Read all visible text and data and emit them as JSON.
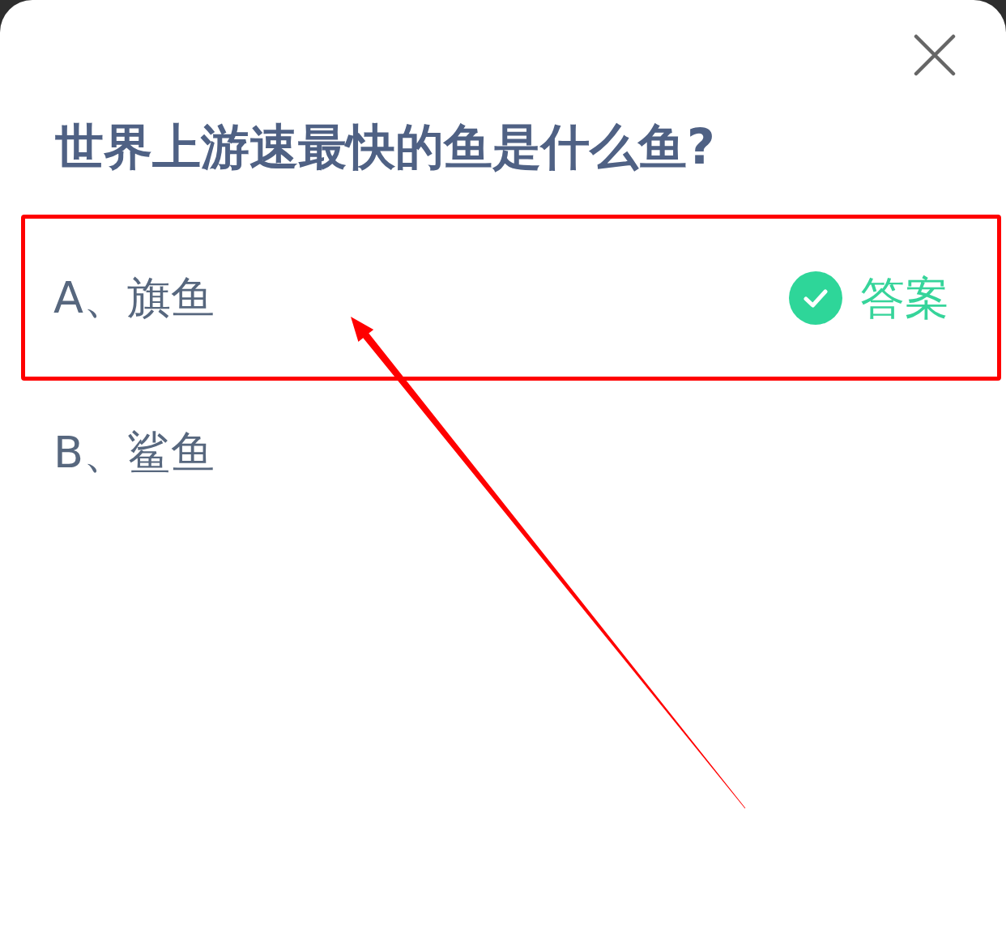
{
  "question": {
    "title": "世界上游速最快的鱼是什么鱼?"
  },
  "options": [
    {
      "label": "A、旗鱼",
      "correct": true,
      "answer_tag": "答案",
      "highlighted": true
    },
    {
      "label": "B、鲨鱼",
      "correct": false,
      "highlighted": false
    }
  ]
}
